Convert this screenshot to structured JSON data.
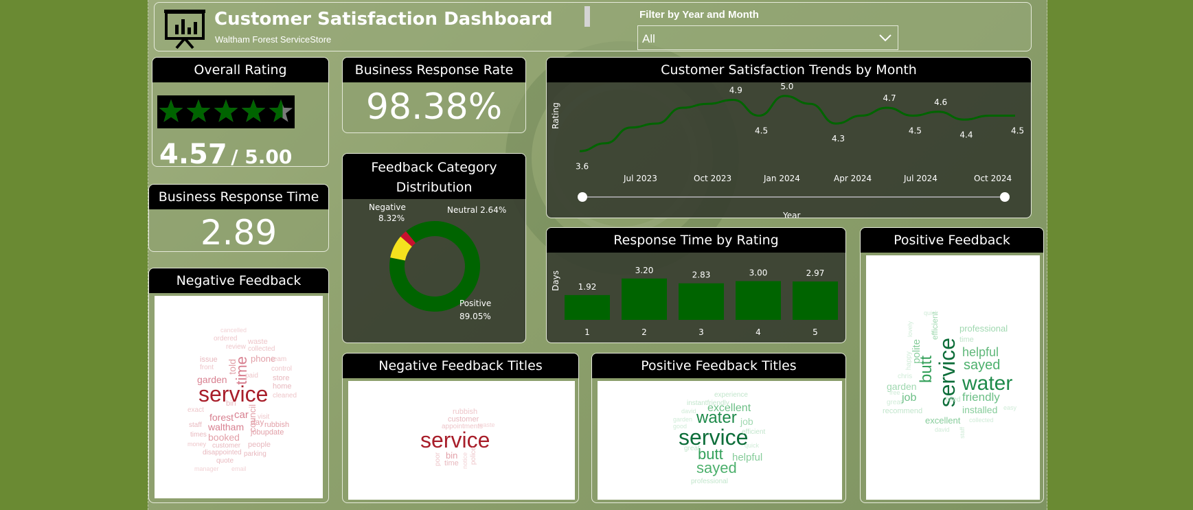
{
  "header": {
    "title": "Customer Satisfaction Dashboard",
    "subtitle": "Waltham Forest ServiceStore",
    "filter_label": "Filter by Year and Month",
    "filter_value": "All"
  },
  "overall_rating": {
    "title": "Overall Rating",
    "value": "4.57",
    "suffix": "/ 5.00",
    "stars": 4.57,
    "star_color": "#006400"
  },
  "response_rate": {
    "title": "Business Response Rate",
    "value": "98.38%"
  },
  "response_time": {
    "title": "Business Response Time",
    "value": "2.89"
  },
  "feedback_distribution": {
    "title_line1": "Feedback Category",
    "title_line2": "Distribution",
    "chart_data": {
      "type": "pie",
      "categories": [
        "Positive",
        "Negative",
        "Neutral"
      ],
      "values": [
        89.05,
        8.32,
        2.64
      ],
      "colors": [
        "#006400",
        "#f5e11e",
        "#c8102e"
      ],
      "labels": [
        "89.05%",
        "8.32%",
        "2.64%"
      ],
      "neutral_label": "Neutral 2.64%"
    }
  },
  "trends": {
    "title": "Customer Satisfaction Trends by Month",
    "chart_data": {
      "type": "line",
      "ylabel": "Rating",
      "xlabel": "Year",
      "x_ticks": [
        "Jul 2023",
        "Oct 2023",
        "Jan 2024",
        "Apr 2024",
        "Jul 2024",
        "Oct 2024"
      ],
      "points": [
        3.6,
        3.8,
        4.2,
        4.3,
        4.7,
        4.8,
        4.9,
        4.5,
        5.0,
        4.8,
        4.3,
        4.5,
        4.7,
        4.5,
        4.6,
        4.4,
        4.5,
        4.5
      ],
      "data_labels": [
        "3.6",
        "4.9",
        "4.5",
        "5.0",
        "4.3",
        "4.7",
        "4.5",
        "4.6",
        "4.4",
        "4.5"
      ],
      "line_color": "#006400"
    }
  },
  "response_by_rating": {
    "title": "Response Time by Rating",
    "chart_data": {
      "type": "bar",
      "ylabel": "Days",
      "categories": [
        "1",
        "2",
        "3",
        "4",
        "5"
      ],
      "values": [
        1.92,
        3.2,
        2.83,
        3.0,
        2.97
      ],
      "labels": [
        "1.92",
        "3.20",
        "2.83",
        "3.00",
        "2.97"
      ],
      "bar_color": "#006400"
    }
  },
  "negative_feedback": {
    "title": "Negative Feedback",
    "words": [
      "service",
      "time",
      "told",
      "council",
      "car",
      "forest",
      "waltham",
      "booked",
      "garden",
      "phone",
      "store",
      "home",
      "day",
      "rubbish",
      "jobupdate",
      "customer",
      "people",
      "parking",
      "staff",
      "times",
      "money",
      "quote",
      "disappointed",
      "waste",
      "collected",
      "review",
      "team",
      "control",
      "cleaned",
      "exact",
      "paid",
      "issue",
      "front",
      "bin",
      "ordered",
      "visit",
      "cancelled",
      "email",
      "manager"
    ]
  },
  "positive_feedback": {
    "title": "Positive Feedback",
    "words": [
      "service",
      "water",
      "butt",
      "sayed",
      "helpful",
      "friendly",
      "job",
      "polite",
      "efficient",
      "installed",
      "professional",
      "garden",
      "excellent",
      "recommend",
      "time",
      "fitted",
      "happy",
      "chris",
      "great",
      "free",
      "easy",
      "quick",
      "david",
      "lovely",
      "collected",
      "staff"
    ]
  },
  "negative_titles": {
    "title": "Negative Feedback Titles",
    "words": [
      "service",
      "rubbish",
      "customer",
      "appointments",
      "bin",
      "time",
      "poor",
      "police",
      "notice",
      "waste"
    ]
  },
  "positive_titles": {
    "title": "Positive Feedback Titles",
    "words": [
      "service",
      "water",
      "butt",
      "sayed",
      "excellent",
      "helpful",
      "job",
      "experience",
      "instantfriendly",
      "professional",
      "efficient",
      "great",
      "garden",
      "good",
      "david",
      "quick"
    ]
  }
}
